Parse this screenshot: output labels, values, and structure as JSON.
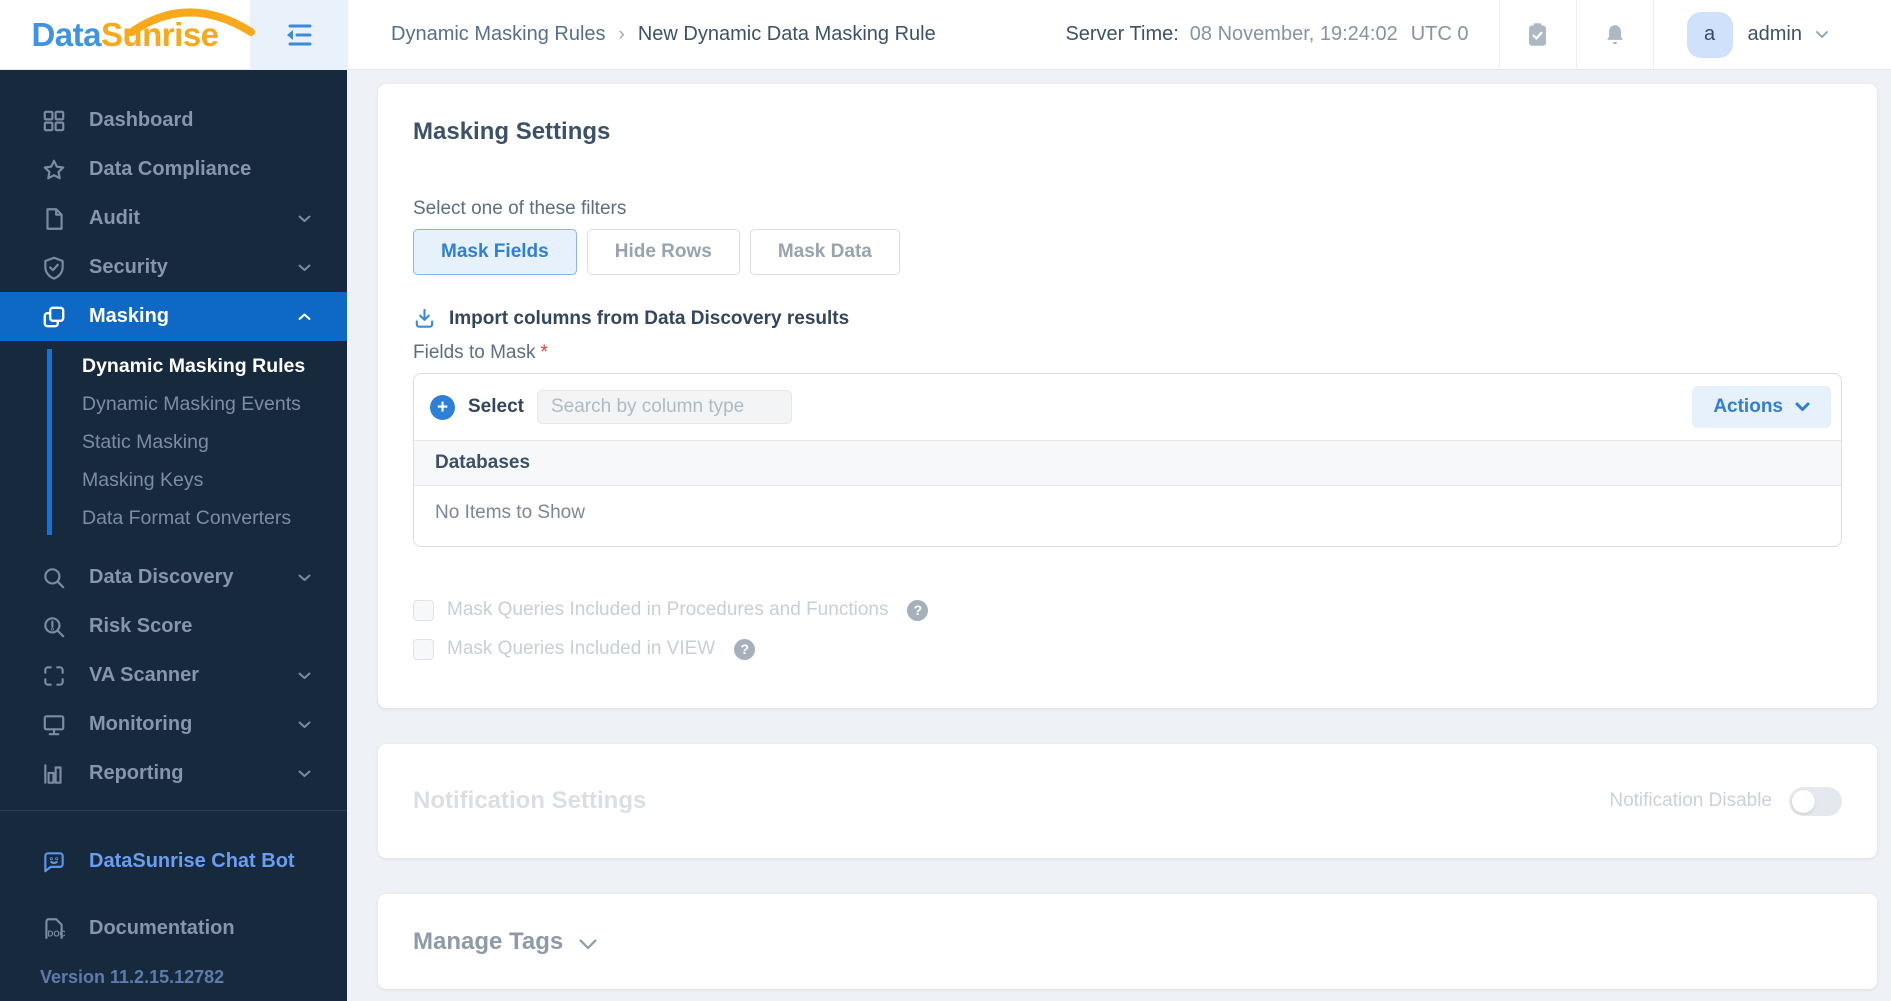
{
  "topbar": {
    "logo_part1": "Data",
    "logo_part2": "Sunrise",
    "breadcrumb": {
      "parent": "Dynamic Masking Rules",
      "separator": "›",
      "current": "New Dynamic Data Masking Rule"
    },
    "server_time_label": "Server Time:",
    "server_time_value": "08 November, 19:24:02",
    "server_time_zone": "UTC 0",
    "user": {
      "avatar_initial": "a",
      "name": "admin"
    }
  },
  "sidebar": {
    "items": [
      {
        "label": "Dashboard",
        "icon": "dashboard-grid-icon"
      },
      {
        "label": "Data Compliance",
        "icon": "star-icon"
      },
      {
        "label": "Audit",
        "icon": "audit-file-icon"
      },
      {
        "label": "Security",
        "icon": "security-shield-icon"
      },
      {
        "label": "Masking",
        "icon": "masking-squares-icon",
        "active": true,
        "expanded": true
      },
      {
        "label": "Data Discovery",
        "icon": "search-icon"
      },
      {
        "label": "Risk Score",
        "icon": "risk-score-icon"
      },
      {
        "label": "VA Scanner",
        "icon": "scanner-icon"
      },
      {
        "label": "Monitoring",
        "icon": "monitor-icon"
      },
      {
        "label": "Reporting",
        "icon": "bar-chart-icon"
      }
    ],
    "masking_submenu": [
      {
        "label": "Dynamic Masking Rules",
        "active": true
      },
      {
        "label": "Dynamic Masking Events"
      },
      {
        "label": "Static Masking"
      },
      {
        "label": "Masking Keys"
      },
      {
        "label": "Data Format Converters"
      }
    ],
    "chatbot_label": "DataSunrise Chat Bot",
    "documentation_label": "Documentation",
    "version": "Version 11.2.15.12782"
  },
  "main": {
    "masking_settings": {
      "title": "Masking Settings",
      "filter_label": "Select one of these filters",
      "filters": [
        {
          "label": "Mask Fields",
          "active": true
        },
        {
          "label": "Hide Rows",
          "active": false
        },
        {
          "label": "Mask Data",
          "active": false
        }
      ],
      "import_link": "Import columns from Data Discovery results",
      "fields_label": "Fields to Mask",
      "required_mark": "*",
      "select_label": "Select",
      "search_placeholder": "Search by column type",
      "actions_label": "Actions",
      "table_header": "Databases",
      "empty_text": "No Items to Show",
      "plus_glyph": "+",
      "help_glyph": "?",
      "checkboxes": [
        {
          "label": "Mask Queries Included in Procedures and Functions",
          "checked": false
        },
        {
          "label": "Mask Queries Included in VIEW",
          "checked": false
        }
      ]
    },
    "notification_settings": {
      "title": "Notification Settings",
      "toggle_label": "Notification Disable",
      "toggle_on": false
    },
    "manage_tags": {
      "title": "Manage Tags"
    }
  },
  "colors": {
    "accent_blue": "#2e7fd6",
    "sidebar_bg": "#17293c",
    "sidebar_active_bg": "#0d68c6",
    "logo_blue": "#3f93e0",
    "logo_orange": "#f7a81b",
    "main_bg": "#eef1f5",
    "dark_text": "#3c5166",
    "disabled_text": "#c6cfd8",
    "required_red": "#e23b3b"
  }
}
